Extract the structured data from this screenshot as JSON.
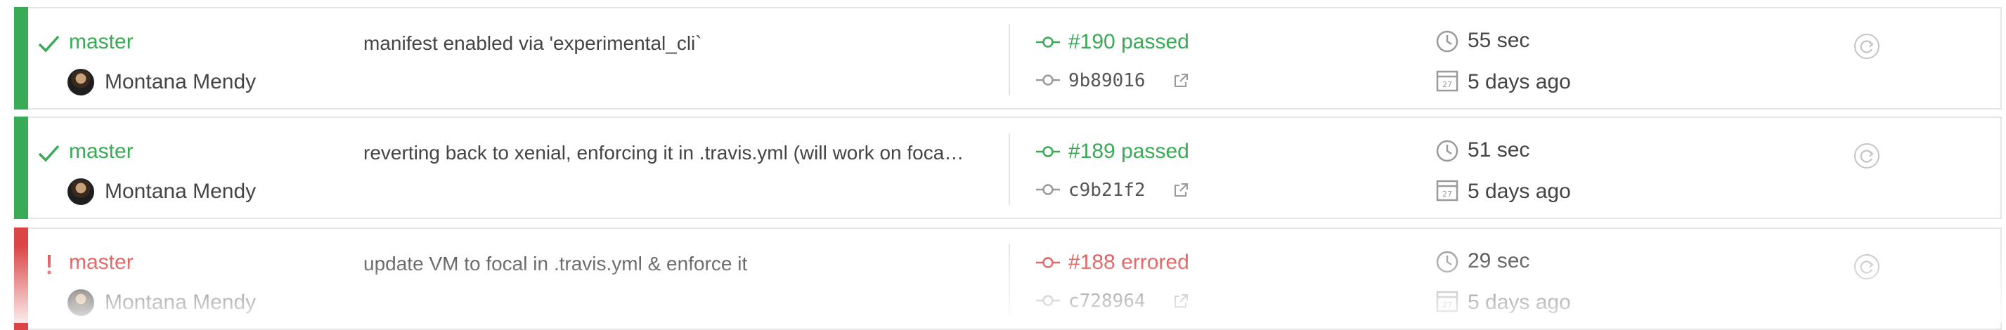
{
  "builds": [
    {
      "state": "passed",
      "status_icon": "check-icon",
      "branch": "master",
      "author": "Montana Mendy",
      "message": "manifest enabled via 'experimental_cli`",
      "build_label": "#190 passed",
      "commit": "9b89016",
      "duration": "55 sec",
      "finished": "5 days ago"
    },
    {
      "state": "passed",
      "status_icon": "check-icon",
      "branch": "master",
      "author": "Montana Mendy",
      "message": "reverting back to xenial, enforcing it in .travis.yml (will work on foca…",
      "build_label": "#189 passed",
      "commit": "c9b21f2",
      "duration": "51 sec",
      "finished": "5 days ago"
    },
    {
      "state": "errored",
      "status_icon": "exclamation-icon",
      "branch": "master",
      "author": "Montana Mendy",
      "message": "update VM to focal in .travis.yml & enforce it",
      "build_label": "#188 errored",
      "commit": "c728964",
      "duration": "29 sec",
      "finished": "5 days ago"
    }
  ],
  "colors": {
    "passed": "#39aa56",
    "errored": "#db4545",
    "border": "#e6e6e6",
    "icon_gray": "#9a9a9a"
  },
  "calendar_day": "27"
}
